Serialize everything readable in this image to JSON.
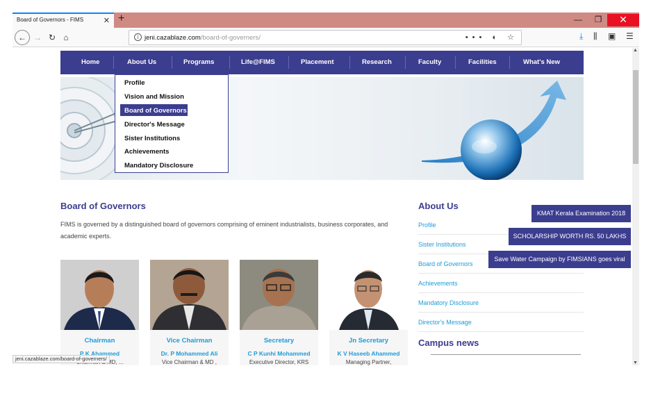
{
  "browser": {
    "tab_title": "Board of Governors - FIMS",
    "tab_close": "✕",
    "new_tab": "+",
    "url_domain": "jeni.cazablaze.com",
    "url_path": "/board-of-governers/",
    "url_actions": "••• ◐ ☆",
    "win_min": "—",
    "win_max": "❐",
    "win_close": "✕"
  },
  "nav": {
    "items": [
      "Home",
      "About Us",
      "Programs",
      "Life@FIMS",
      "Placement",
      "Research",
      "Faculty",
      "Facilities",
      "What's New"
    ]
  },
  "dropdown": {
    "items": [
      "Profile",
      "Vision and Mission",
      "Board of Governors",
      "Director's Message",
      "Sister Institutions",
      "Achievements",
      "Mandatory Disclosure"
    ],
    "active_index": 2
  },
  "main": {
    "heading": "Board of Governors",
    "intro": "FIMS is governed by a distinguished board of governors comprising of eminent industrialists, business corporates, and academic experts.",
    "people": [
      {
        "role": "Chairman",
        "name": "P K Ahammed",
        "desc": "Chairman & MD, ..."
      },
      {
        "role": "Vice Chairman",
        "name": "Dr. P Mohammed Ali",
        "desc": "Vice Chairman & MD ,"
      },
      {
        "role": "Secretary",
        "name": "C P Kunhi Mohammed",
        "desc": "Executive Director, KRS"
      },
      {
        "role": "Jn Secretary",
        "name": "K V Haseeb Ahammed",
        "desc": "Managing Partner,"
      }
    ]
  },
  "sidebar": {
    "heading": "About Us",
    "links": [
      "Profile",
      "Sister Institutions",
      "Board of Governors",
      "Achievements",
      "Mandatory Disclosure",
      "Director's Message"
    ],
    "news_heading": "Campus news"
  },
  "floating": [
    "KMAT Kerala Examination 2018",
    "SCHOLARSHIP WORTH RS. 50 LAKHS",
    "Save Water Campaign by FIMSIANS goes viral"
  ],
  "status_url": "jeni.cazablaze.com/board-of-governers/",
  "colors": {
    "brand": "#3b3d8f",
    "link": "#1e9bd7",
    "tab_strip": "#d08a84",
    "close": "#e81123"
  }
}
